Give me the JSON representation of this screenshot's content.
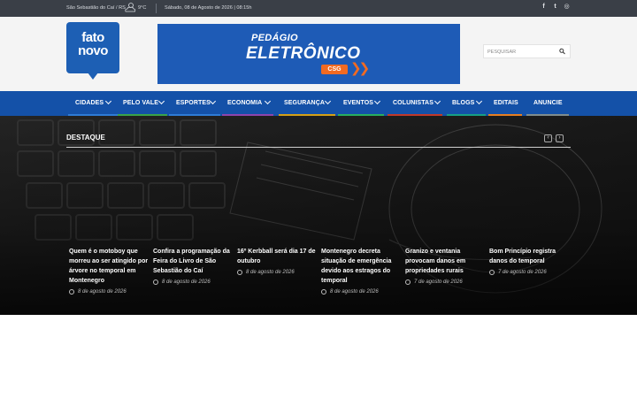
{
  "topbar": {
    "location": "São Sebastião do Caí / RS",
    "weather_icon": "cloud-sun-icon",
    "temperature": "9°C",
    "date": "Sábado, 08 de Agosto de 2026 | 08:15h",
    "social": [
      {
        "icon": "facebook-icon",
        "glyph": "f"
      },
      {
        "icon": "twitter-icon",
        "glyph": "t"
      },
      {
        "icon": "instagram-icon",
        "glyph": "◎"
      }
    ]
  },
  "header": {
    "logo_line1": "fato",
    "logo_line2": "novo",
    "banner_line1": "PEDÁGIO",
    "banner_line2": "ELETRÔNICO",
    "banner_brand": "CSG",
    "banner_arrows": "❯❯",
    "search_placeholder": "PESQUISAR"
  },
  "nav": {
    "items": [
      {
        "label": "CIDADES",
        "caret": true,
        "underline": "#2e7bd6"
      },
      {
        "label": "PELO VALE",
        "caret": true,
        "underline": "#3aa34a"
      },
      {
        "label": "ESPORTES",
        "caret": true,
        "underline": "#2e7bd6"
      },
      {
        "label": "ECONOMIA",
        "caret": true,
        "underline": "#8e44ad"
      },
      {
        "label": "SEGURANÇA",
        "caret": true,
        "underline": "#d4a017"
      },
      {
        "label": "EVENTOS",
        "caret": true,
        "underline": "#27ae60"
      },
      {
        "label": "COLUNISTAS",
        "caret": true,
        "underline": "#c0392b"
      },
      {
        "label": "BLOGS",
        "caret": true,
        "underline": "#16a085"
      },
      {
        "label": "EDITAIS",
        "caret": false,
        "underline": "#e67e22"
      },
      {
        "label": "ANUNCIE",
        "caret": false,
        "underline": "#7f8c8d"
      }
    ]
  },
  "highlight": {
    "title": "DESTAQUE",
    "prev": "‹",
    "next": "›",
    "articles": [
      {
        "title": "Quem é o motoboy que morreu ao ser atingido por árvore no temporal em Montenegro",
        "date": "8 de agosto de 2026"
      },
      {
        "title": "Confira a programação da Feira do Livro de São Sebastião do Caí",
        "date": "8 de agosto de 2026"
      },
      {
        "title": "16º Kerbball será dia 17 de outubro",
        "date": "8 de agosto de 2026"
      },
      {
        "title": "Montenegro decreta situação de emergência devido aos estragos do temporal",
        "date": "8 de agosto de 2026"
      },
      {
        "title": "Granizo e ventania provocam danos em propriedades rurais",
        "date": "7 de agosto de 2026"
      },
      {
        "title": "Bom Princípio registra danos do temporal",
        "date": "7 de agosto de 2026"
      }
    ]
  }
}
